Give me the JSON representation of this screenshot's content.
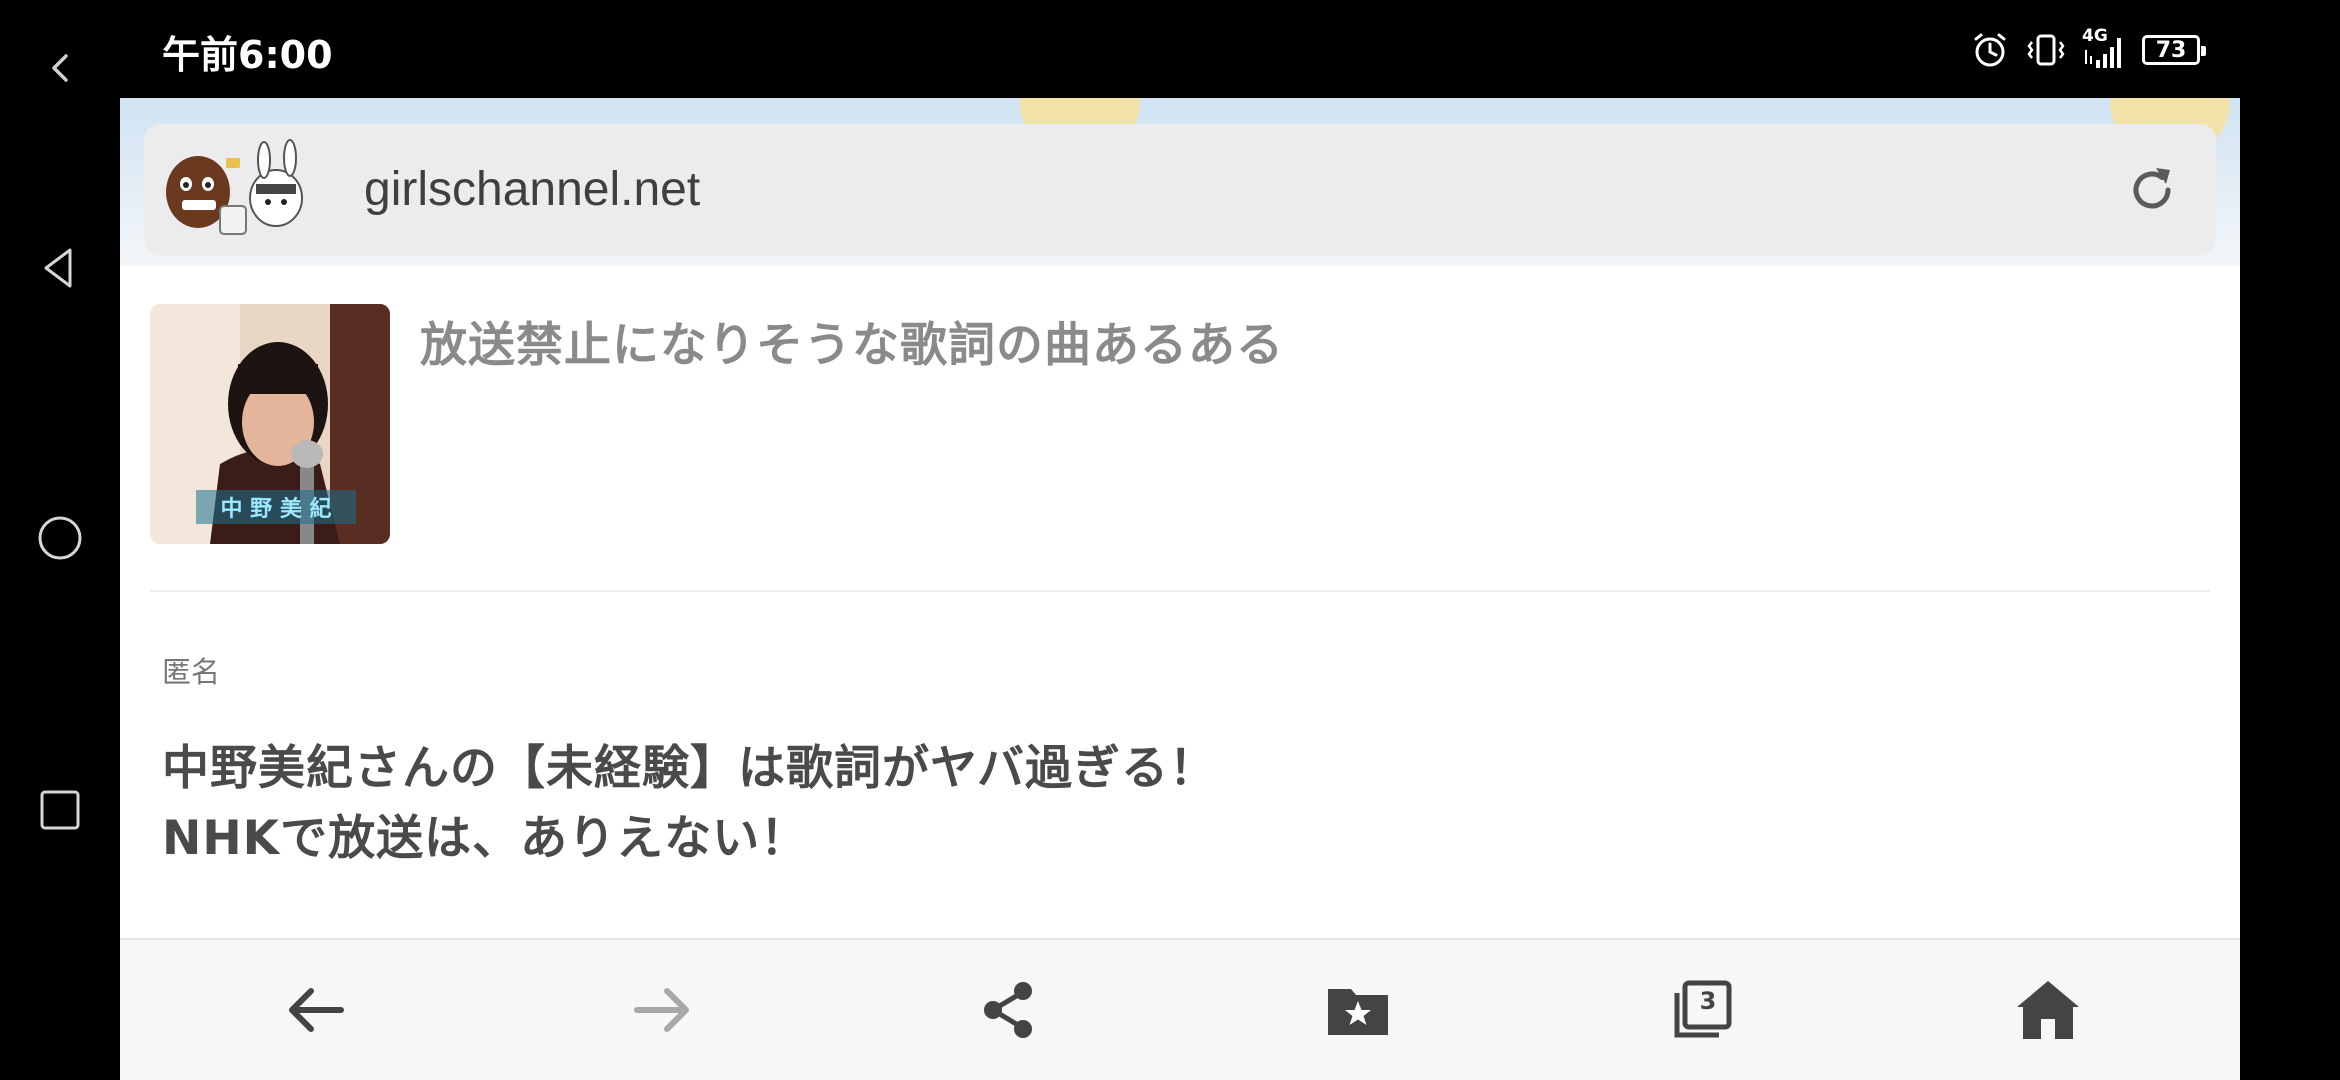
{
  "status_bar": {
    "time": "午前6:00",
    "network": "4G",
    "battery": "73"
  },
  "browser": {
    "url": "girlschannel.net"
  },
  "topic": {
    "title": "放送禁止になりそうな歌詞の曲あるある",
    "thumbnail_caption": "中 野 美 紀"
  },
  "comment": {
    "author": "匿名",
    "lines": [
      "中野美紀さんの【未経験】は歌詞がヤバ過ぎる！",
      "NHKで放送は、ありえない！"
    ]
  },
  "toolbar": {
    "tab_count": "3"
  },
  "icons": {
    "nav": [
      "chevron-left-icon",
      "triangle-back-icon",
      "circle-home-icon",
      "square-recents-icon"
    ],
    "status": [
      "alarm-icon",
      "vibrate-icon",
      "signal-icon",
      "battery-icon"
    ],
    "toolbar": [
      "arrow-back-icon",
      "arrow-forward-icon",
      "share-icon",
      "bookmark-folder-icon",
      "tabs-icon",
      "home-icon"
    ]
  },
  "colors": {
    "title_gray": "#8a8a8a",
    "body_text": "#4a4a4a",
    "icon_dark": "#444444",
    "icon_disabled": "#a8a8a8"
  }
}
